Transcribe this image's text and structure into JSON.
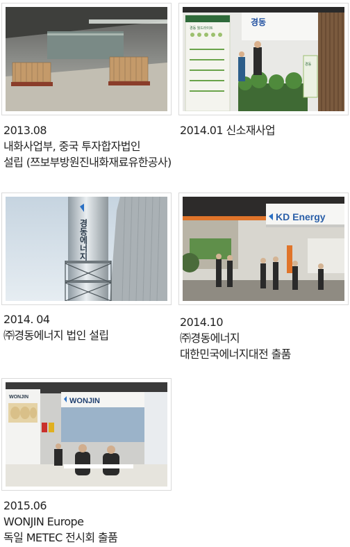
{
  "timeline": [
    {
      "date": "2013.08",
      "lines": [
        "내화사업부, 중국 투자합자법인",
        "설립 (쯔보부방원진내화재료유한공사)"
      ],
      "photo": "kiln-factory-photo"
    },
    {
      "date": "2014.01 신소재사업",
      "lines": [],
      "photo": "exhibition-booth-photo",
      "photo_text": {
        "logo": "경동",
        "sign": "경동 월드라이트",
        "banner": "경동"
      }
    },
    {
      "date": "2014. 04",
      "lines": [
        "㈜경동에너지 법인 설립"
      ],
      "photo": "energy-tower-photo",
      "photo_text": {
        "tower": "경동에너지"
      }
    },
    {
      "date": "2014.10",
      "lines": [
        "㈜경동에너지",
        "대한민국에너지대전 출품"
      ],
      "photo": "kd-energy-booth-photo",
      "photo_text": {
        "sign": "KD Energy"
      }
    },
    {
      "date": "2015.06",
      "lines": [
        "WONJIN Europe",
        "독일 METEC 전시회 출품"
      ],
      "photo": "wonjin-booth-photo",
      "photo_text": {
        "sign": "WONJIN",
        "banner": "WONJIN"
      }
    }
  ]
}
